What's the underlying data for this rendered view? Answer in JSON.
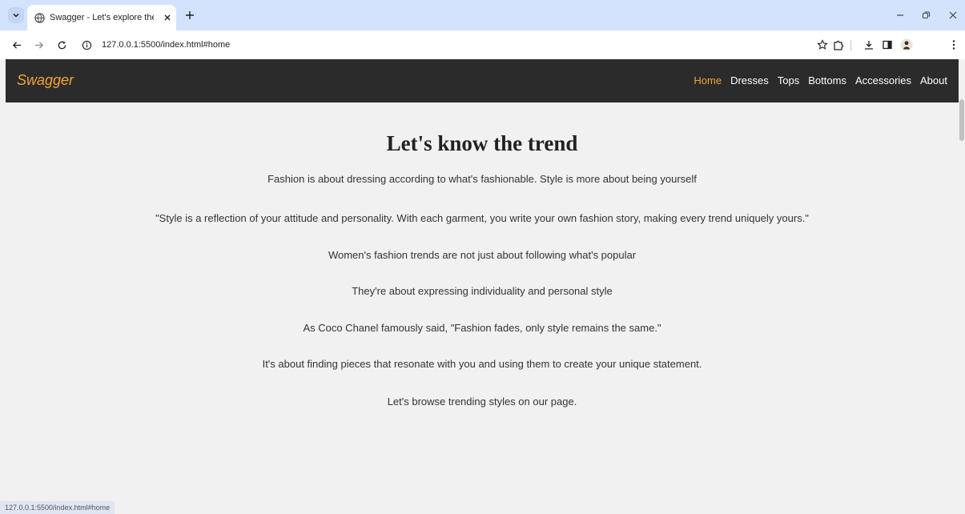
{
  "browser": {
    "tab_title": "Swagger - Let's explore the trend",
    "url": "127.0.0.1:5500/index.html#home",
    "status_url": "127.0.0.1:5500/index.html#home"
  },
  "site": {
    "brand": "Swagger",
    "accent_color": "#f2a33a",
    "nav": [
      {
        "label": "Home",
        "active": true
      },
      {
        "label": "Dresses"
      },
      {
        "label": "Tops"
      },
      {
        "label": "Bottoms"
      },
      {
        "label": "Accessories"
      },
      {
        "label": "About"
      }
    ]
  },
  "main": {
    "headline": "Let's know the trend",
    "paragraphs": [
      "Fashion is about dressing according to what's fashionable. Style is more about being yourself",
      "\"Style is a reflection of your attitude and personality. With each garment, you write your own fashion story, making every trend uniquely yours.\"",
      "Women's fashion trends are not just about following what's popular",
      "They're about expressing individuality and personal style",
      "As Coco Chanel famously said, \"Fashion fades, only style remains the same.\"",
      "It's about finding pieces that resonate with you and using them to create your unique statement.",
      "Let's browse trending styles on our page."
    ]
  },
  "icons": {
    "tab_search": "chevron-down-icon",
    "favicon": "globe-icon",
    "tab_close": "close-icon",
    "new_tab": "plus-icon",
    "back": "back-arrow-icon",
    "forward": "forward-arrow-icon",
    "reload": "reload-icon",
    "site_info": "info-icon",
    "bookmark": "star-icon",
    "extensions": "puzzle-icon",
    "downloads": "download-icon",
    "side_panel": "side-panel-icon",
    "profile": "avatar-icon",
    "menu": "kebab-menu-icon"
  }
}
